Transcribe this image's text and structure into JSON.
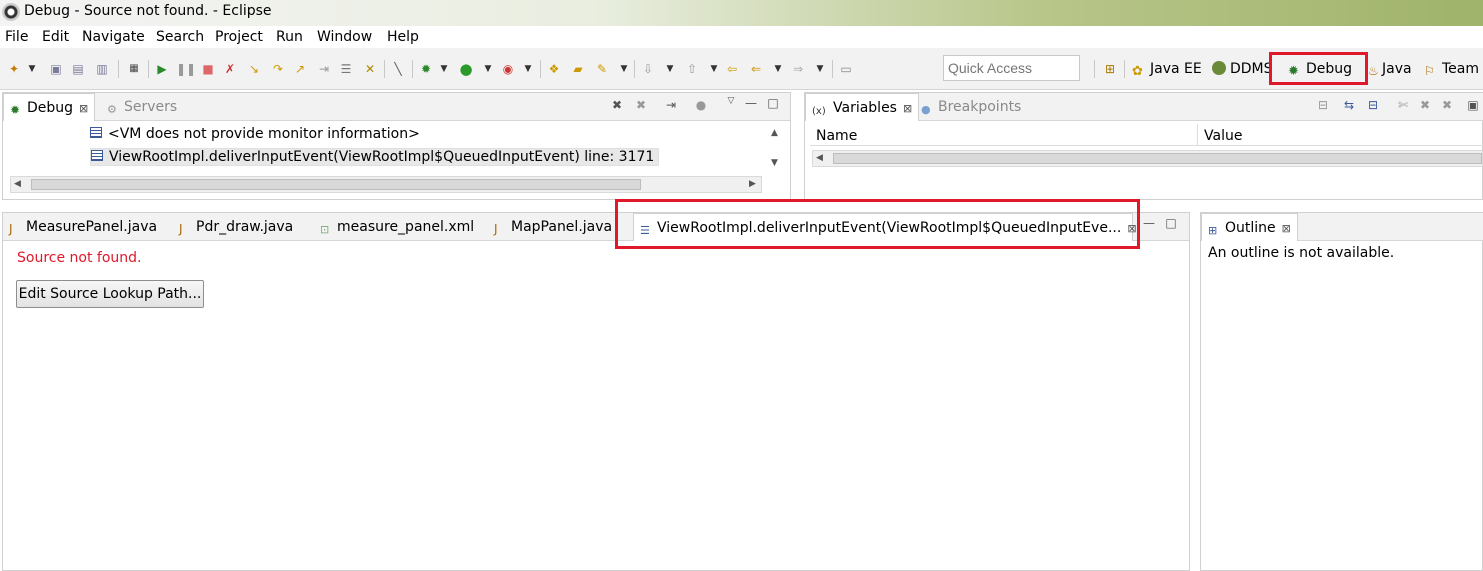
{
  "window": {
    "title": "Debug - Source not found. - Eclipse"
  },
  "menu": [
    "File",
    "Edit",
    "Navigate",
    "Search",
    "Project",
    "Run",
    "Window",
    "Help"
  ],
  "quick_access": {
    "placeholder": "Quick Access"
  },
  "perspectives": [
    {
      "label": "Java EE",
      "icon": "java-ee-icon"
    },
    {
      "label": "DDMS",
      "icon": "ddms-icon"
    },
    {
      "label": "Debug",
      "icon": "debug-icon",
      "highlighted": true
    },
    {
      "label": "Java",
      "icon": "java-icon"
    },
    {
      "label": "Team",
      "icon": "team-icon"
    }
  ],
  "debug_view": {
    "tabs": [
      {
        "label": "Debug",
        "active": true
      },
      {
        "label": "Servers",
        "active": false
      }
    ],
    "stack": [
      "<VM does not provide monitor information>",
      "ViewRootImpl.deliverInputEvent(ViewRootImpl$QueuedInputEvent) line: 3171"
    ]
  },
  "variables_view": {
    "tabs": [
      {
        "label": "Variables",
        "active": true
      },
      {
        "label": "Breakpoints",
        "active": false
      }
    ],
    "columns": [
      "Name",
      "Value"
    ]
  },
  "editor": {
    "tabs": [
      {
        "label": "MeasurePanel.java"
      },
      {
        "label": "Pdr_draw.java"
      },
      {
        "label": "measure_panel.xml"
      },
      {
        "label": "MapPanel.java"
      },
      {
        "label": "ViewRootImpl.deliverInputEvent(ViewRootImpl$QueuedInputEve...",
        "active": true
      }
    ],
    "message": "Source not found.",
    "button": "Edit Source Lookup Path..."
  },
  "outline": {
    "tab": "Outline",
    "message": "An outline is not available."
  },
  "colors": {
    "highlight": "#e0182b",
    "error_text": "#e0182b"
  }
}
